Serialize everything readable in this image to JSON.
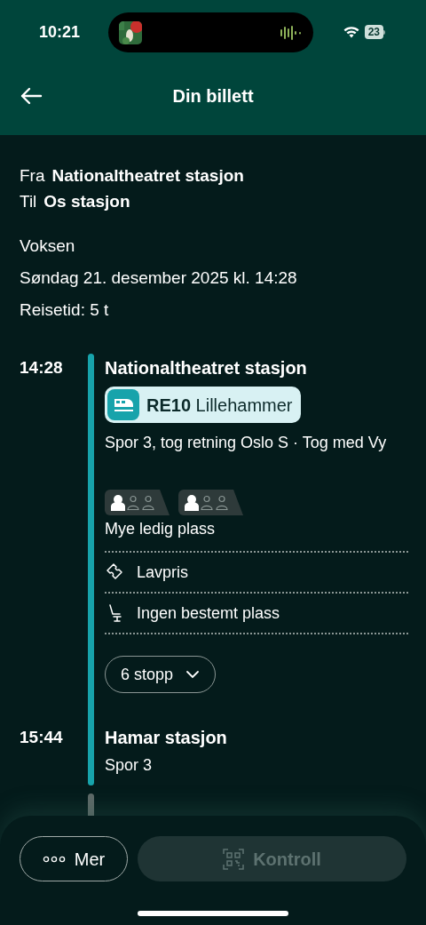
{
  "status_bar": {
    "time": "10:21",
    "battery": "23"
  },
  "header": {
    "title": "Din billett"
  },
  "route": {
    "from_label": "Fra",
    "from": "Nationaltheatret stasjon",
    "to_label": "Til",
    "to": "Os stasjon"
  },
  "details": [
    "Voksen",
    "Søndag 21. desember 2025 kl. 14:28",
    "Reisetid: 5 t"
  ],
  "legs": [
    {
      "kind": "departure",
      "time": "14:28",
      "station": "Nationaltheatret stasjon",
      "line": {
        "code": "RE10",
        "destination": "Lillehammer"
      },
      "info": "Spor 3, tog retning Oslo S · Tog med Vy",
      "cars": [
        {
          "stars": 1
        },
        {
          "stars": 1
        }
      ],
      "occupancy": "Mye ledig plass",
      "features": [
        {
          "kind": "ticket",
          "label": "Lavpris"
        },
        {
          "kind": "seat",
          "label": "Ingen bestemt plass"
        }
      ],
      "stops_button": "6 stopp"
    },
    {
      "kind": "arrival",
      "time": "15:44",
      "station": "Hamar stasjon",
      "info": "Spor 3"
    }
  ],
  "actions": [
    {
      "kind": "more",
      "label": "Mer",
      "disabled": false
    },
    {
      "kind": "qr",
      "label": "Kontroll",
      "disabled": true
    }
  ]
}
